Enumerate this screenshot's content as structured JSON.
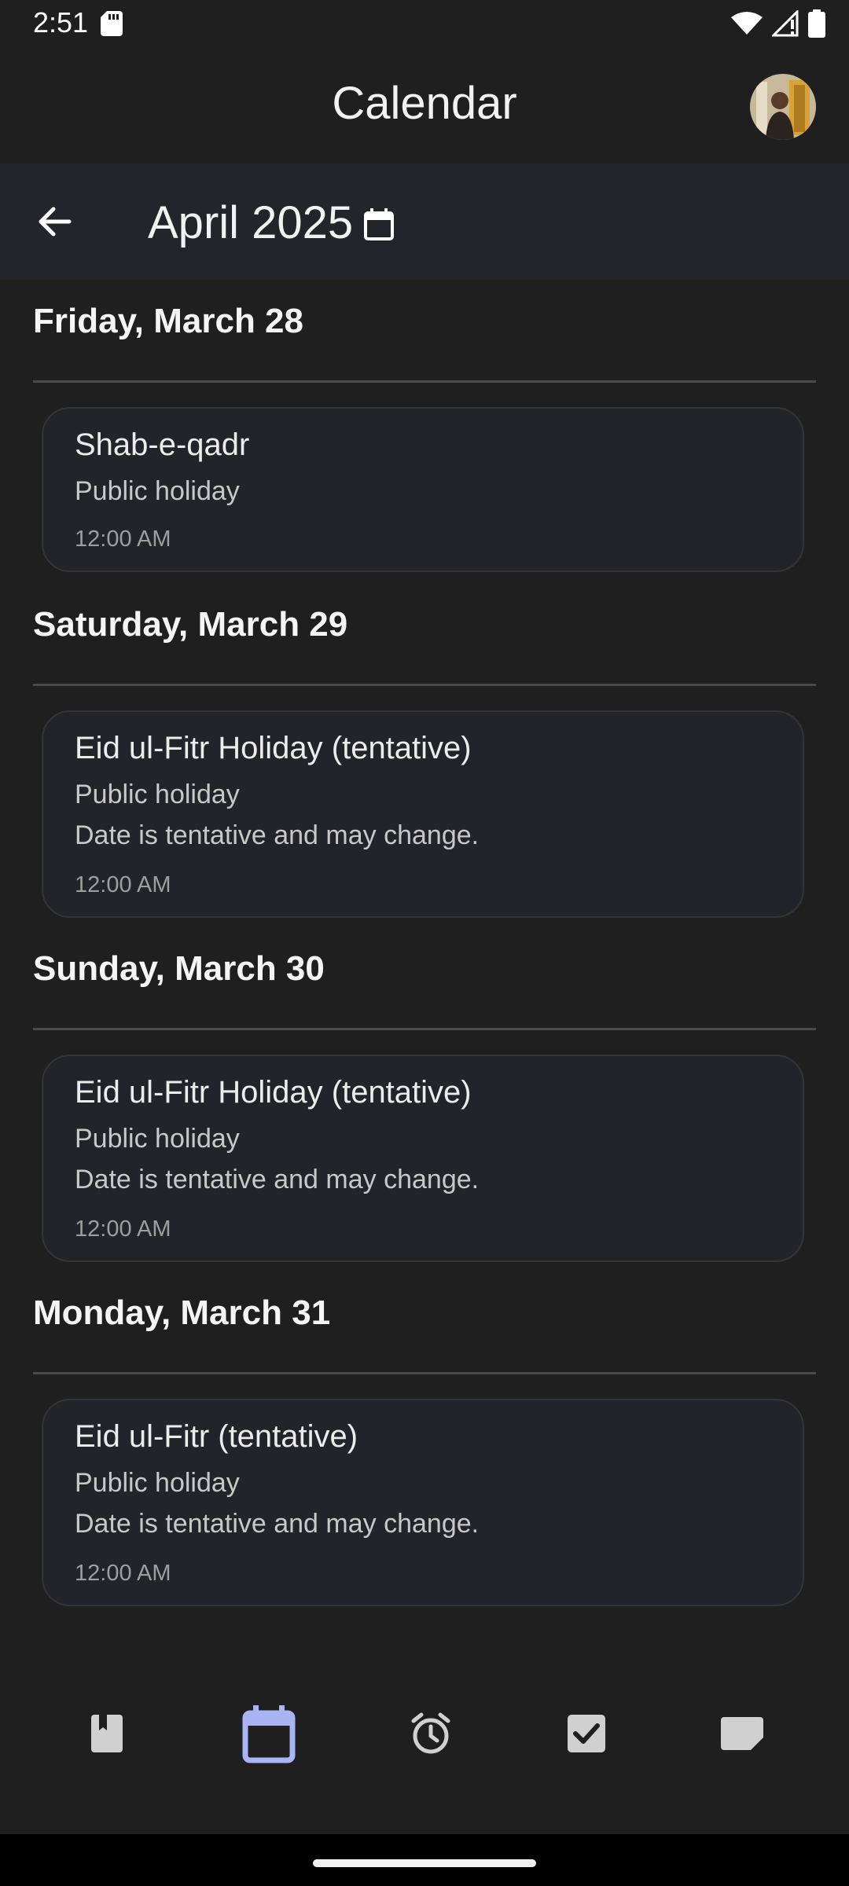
{
  "status_bar": {
    "time": "2:51",
    "icons": [
      "sd-card-icon",
      "wifi-icon",
      "signal-icon",
      "battery-icon"
    ]
  },
  "app_bar": {
    "title": "Calendar",
    "avatar": "user-avatar"
  },
  "month_header": {
    "label": "April 2025",
    "back_icon": "arrow-left-icon",
    "calendar_icon": "calendar-icon"
  },
  "days": [
    {
      "heading": "Friday, March 28",
      "event": {
        "title": "Shab-e-qadr",
        "type": "Public holiday",
        "note": "",
        "time": "12:00 AM"
      }
    },
    {
      "heading": "Saturday, March 29",
      "event": {
        "title": "Eid ul-Fitr Holiday (tentative)",
        "type": "Public holiday",
        "note": "Date is tentative and may change.",
        "time": "12:00 AM"
      }
    },
    {
      "heading": "Sunday, March 30",
      "event": {
        "title": "Eid ul-Fitr Holiday (tentative)",
        "type": "Public holiday",
        "note": "Date is tentative and may change.",
        "time": "12:00 AM"
      }
    },
    {
      "heading": "Monday, March 31",
      "event": {
        "title": "Eid ul-Fitr (tentative)",
        "type": "Public holiday",
        "note": "Date is tentative and may change.",
        "time": "12:00 AM"
      }
    }
  ],
  "bottom_nav": {
    "items": [
      "book-icon",
      "calendar-icon",
      "alarm-icon",
      "checkbox-icon",
      "note-icon"
    ],
    "active": "calendar-icon"
  },
  "colors": {
    "background": "#1f1f1f",
    "header_band": "#24242b",
    "card": "#23232a",
    "accent": "#a9b4f5"
  }
}
